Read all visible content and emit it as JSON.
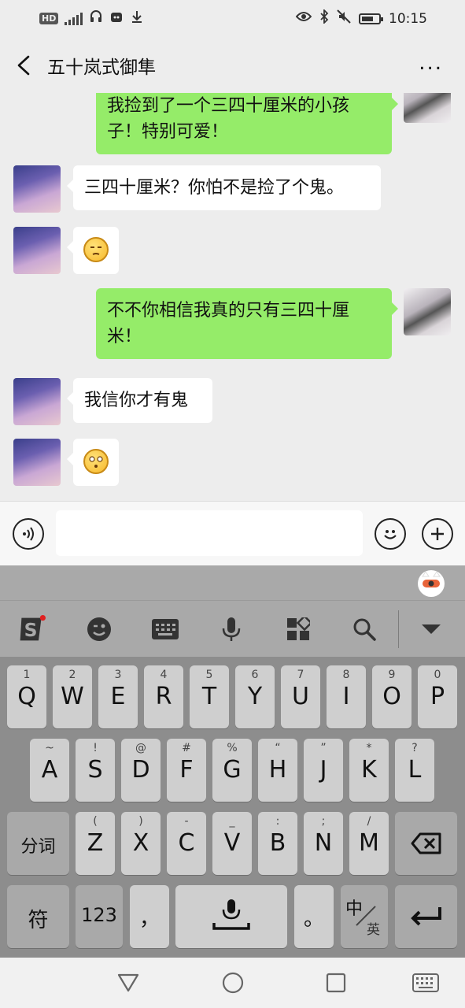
{
  "status_bar": {
    "left_icons": [
      "hd-icon",
      "4g-signal-icon",
      "headset-icon",
      "app-notification-icon",
      "download-icon"
    ],
    "hd_label": "HD",
    "right_icons": [
      "eye-icon",
      "bluetooth-icon",
      "mute-icon",
      "battery-icon"
    ],
    "time": "10:15"
  },
  "header": {
    "title": "五十岚式御隼",
    "back_icon": "chevron-left-icon",
    "more_icon": "more-dots-icon",
    "more_label": "..."
  },
  "messages": [
    {
      "side": "me",
      "text": "我捡到了一个三四十厘米的小孩子！特别可爱！"
    },
    {
      "side": "other",
      "text": "三四十厘米？你怕不是捡了个鬼。"
    },
    {
      "side": "other",
      "emoji": "unamused-face-icon"
    },
    {
      "side": "me",
      "text": "不不你相信我真的只有三四十厘米！"
    },
    {
      "side": "other",
      "text": "我信你才有鬼"
    },
    {
      "side": "other",
      "emoji": "flushed-face-icon"
    }
  ],
  "input_bar": {
    "voice_icon": "voice-icon",
    "emoji_icon": "emoji-icon",
    "plus_icon": "plus-icon",
    "placeholder": ""
  },
  "keyboard": {
    "toolbar": [
      "sogou-logo-icon",
      "wink-face-icon",
      "keyboard-icon",
      "microphone-icon",
      "apps-grid-icon",
      "search-icon",
      "collapse-arrow-icon"
    ],
    "row1": [
      {
        "main": "Q",
        "sub": "1"
      },
      {
        "main": "W",
        "sub": "2"
      },
      {
        "main": "E",
        "sub": "3"
      },
      {
        "main": "R",
        "sub": "4"
      },
      {
        "main": "T",
        "sub": "5"
      },
      {
        "main": "Y",
        "sub": "6"
      },
      {
        "main": "U",
        "sub": "7"
      },
      {
        "main": "I",
        "sub": "8"
      },
      {
        "main": "O",
        "sub": "9"
      },
      {
        "main": "P",
        "sub": "0"
      }
    ],
    "row2": [
      {
        "main": "A",
        "sub": "~"
      },
      {
        "main": "S",
        "sub": "!"
      },
      {
        "main": "D",
        "sub": "@"
      },
      {
        "main": "F",
        "sub": "#"
      },
      {
        "main": "G",
        "sub": "%"
      },
      {
        "main": "H",
        "sub": "“"
      },
      {
        "main": "J",
        "sub": "”"
      },
      {
        "main": "K",
        "sub": "*"
      },
      {
        "main": "L",
        "sub": "?"
      }
    ],
    "row3": [
      {
        "main": "Z",
        "sub": "("
      },
      {
        "main": "X",
        "sub": ")"
      },
      {
        "main": "C",
        "sub": "-"
      },
      {
        "main": "V",
        "sub": "_"
      },
      {
        "main": "B",
        "sub": ":"
      },
      {
        "main": "N",
        "sub": ";"
      },
      {
        "main": "M",
        "sub": "/"
      }
    ],
    "split_label": "分词",
    "symbol_label": "符",
    "num_label": "123",
    "comma_label": "，",
    "period_label": "。",
    "lang_main": "中",
    "lang_sub": "英"
  },
  "nav_bar": [
    "back-triangle-icon",
    "home-circle-icon",
    "recents-square-icon",
    "keyboard-switch-icon"
  ]
}
